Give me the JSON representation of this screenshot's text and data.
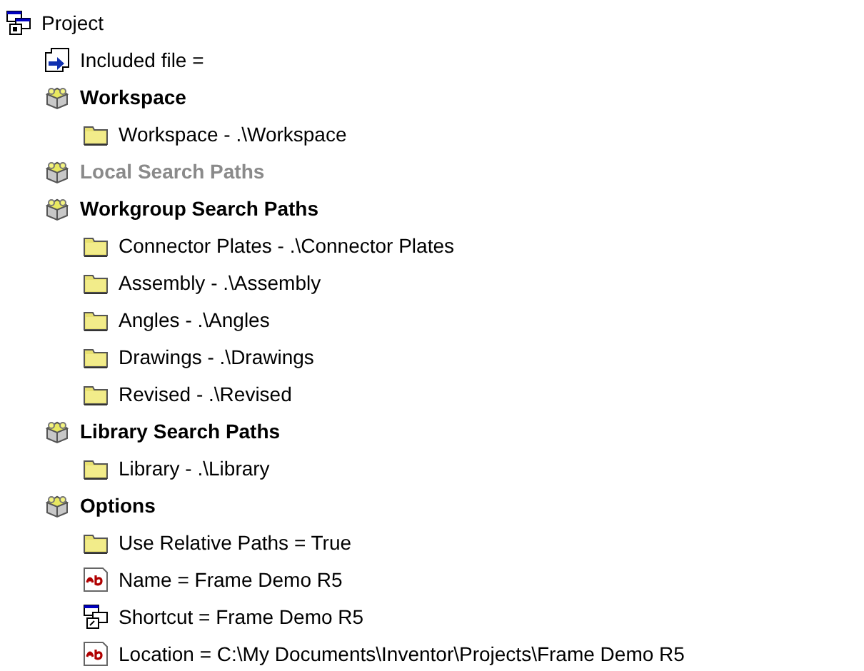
{
  "tree": [
    {
      "kind": "project",
      "label": "Project",
      "children": [
        {
          "kind": "file",
          "label": "Included file ="
        },
        {
          "kind": "group",
          "label": "Workspace",
          "disabled": false,
          "children": [
            {
              "kind": "folder",
              "label": "Workspace - .\\Workspace"
            }
          ]
        },
        {
          "kind": "group",
          "label": "Local Search Paths",
          "disabled": true
        },
        {
          "kind": "group",
          "label": "Workgroup Search Paths",
          "disabled": false,
          "children": [
            {
              "kind": "folder",
              "label": "Connector Plates - .\\Connector Plates"
            },
            {
              "kind": "folder",
              "label": "Assembly - .\\Assembly"
            },
            {
              "kind": "folder",
              "label": "Angles - .\\Angles"
            },
            {
              "kind": "folder",
              "label": "Drawings - .\\Drawings"
            },
            {
              "kind": "folder",
              "label": "Revised - .\\Revised"
            }
          ]
        },
        {
          "kind": "group",
          "label": "Library Search Paths",
          "disabled": false,
          "children": [
            {
              "kind": "folder",
              "label": "Library - .\\Library"
            }
          ]
        },
        {
          "kind": "group",
          "label": "Options",
          "disabled": false,
          "children": [
            {
              "kind": "folder",
              "label": "Use Relative Paths = True"
            },
            {
              "kind": "text",
              "label": "Name = Frame Demo R5"
            },
            {
              "kind": "shortcut",
              "label": "Shortcut = Frame Demo R5"
            },
            {
              "kind": "text",
              "label": "Location = C:\\My Documents\\Inventor\\Projects\\Frame Demo R5"
            }
          ]
        }
      ]
    }
  ]
}
